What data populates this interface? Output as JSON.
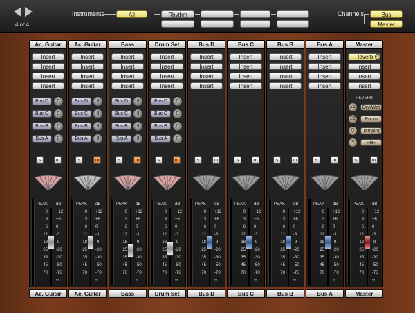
{
  "nav": {
    "page_indicator": "4 of 4",
    "prev_icon": "triangle-left-icon",
    "next_icon": "triangle-right-icon"
  },
  "instruments": {
    "label": "Instruments",
    "all_button": "All",
    "groups": [
      "Rhythm",
      "",
      "",
      "",
      "",
      "",
      "",
      ""
    ]
  },
  "channels": {
    "label": "Channels",
    "buttons": [
      "Bus",
      "Master"
    ]
  },
  "scale_left": [
    "PEAK",
    "0",
    "3",
    "6",
    "12",
    "18",
    "25",
    "35",
    "45",
    "70",
    "-"
  ],
  "scale_right": [
    "dB",
    "+12",
    "+6",
    "0",
    "-3",
    "-9",
    "-20",
    "-30",
    "-50",
    "-70",
    "∞"
  ],
  "colors": {
    "solo_active": "#e8701c",
    "bus_fader": "#2e5990",
    "master_fader": "#8a1414"
  },
  "strips": [
    {
      "name": "Ac. Guitar",
      "inserts": [
        "Insert",
        "Insert",
        "Insert",
        "Insert"
      ],
      "sends": [
        {
          "bus": "Bus D",
          "level": "0"
        },
        {
          "bus": "Bus C",
          "level": "0"
        },
        {
          "bus": "Bus B",
          "level": "0"
        },
        {
          "bus": "Bus A",
          "level": "0"
        }
      ],
      "solo": "s",
      "mute": "m",
      "mute_on": false,
      "pan_color": "#d9a0a0",
      "fader_level": 0.58,
      "fader_style": "gray",
      "footer": "Ac. Guitar"
    },
    {
      "name": "Ac. Guitar",
      "inserts": [
        "Insert",
        "Insert",
        "Insert",
        "Insert"
      ],
      "sends": [
        {
          "bus": "Bus D",
          "level": "0"
        },
        {
          "bus": "Bus C",
          "level": "0"
        },
        {
          "bus": "Bus B",
          "level": "0"
        },
        {
          "bus": "Bus A",
          "level": "0"
        }
      ],
      "solo": "s",
      "mute": "m",
      "mute_on": true,
      "pan_color": "#bdbdbd",
      "fader_level": 0.58,
      "fader_style": "gray",
      "footer": "Ac. Guitar"
    },
    {
      "name": "Bass",
      "inserts": [
        "Insert",
        "Insert",
        "Insert",
        "Insert"
      ],
      "sends": [
        {
          "bus": "Bus D",
          "level": "0"
        },
        {
          "bus": "Bus C",
          "level": "0"
        },
        {
          "bus": "Bus B",
          "level": "0"
        },
        {
          "bus": "Bus A",
          "level": "0"
        }
      ],
      "solo": "s",
      "mute": "m",
      "mute_on": true,
      "pan_color": "#d9a0a0",
      "fader_level": 0.45,
      "fader_style": "gray",
      "footer": "Bass"
    },
    {
      "name": "Drum Set",
      "inserts": [
        "Insert",
        "Insert",
        "Insert",
        "Insert"
      ],
      "sends": [
        {
          "bus": "Bus D",
          "level": "0"
        },
        {
          "bus": "Bus C",
          "level": "0"
        },
        {
          "bus": "Bus B",
          "level": "0"
        },
        {
          "bus": "Bus A",
          "level": "0"
        }
      ],
      "solo": "s",
      "mute": "m",
      "mute_on": true,
      "pan_color": "#d9a0a0",
      "fader_level": 0.48,
      "fader_style": "gray",
      "footer": "Drum Set"
    },
    {
      "name": "Bus D",
      "inserts": [
        "Insert",
        "Insert",
        "Insert",
        "Insert"
      ],
      "sends": [],
      "solo": "s",
      "mute": "m",
      "mute_on": false,
      "pan_color": "#9a9a9a",
      "fader_level": 0.58,
      "fader_style": "blue",
      "footer": "Bus D"
    },
    {
      "name": "Bus C",
      "inserts": [
        "Insert",
        "Insert",
        "Insert",
        "Insert"
      ],
      "sends": [],
      "solo": "s",
      "mute": "m",
      "mute_on": false,
      "pan_color": "#9a9a9a",
      "fader_level": 0.58,
      "fader_style": "blue",
      "footer": "Bus C"
    },
    {
      "name": "Bus B",
      "inserts": [
        "Insert",
        "Insert",
        "Insert",
        "Insert"
      ],
      "sends": [],
      "solo": "s",
      "mute": "m",
      "mute_on": false,
      "pan_color": "#9a9a9a",
      "fader_level": 0.58,
      "fader_style": "blue",
      "footer": "Bus B"
    },
    {
      "name": "Bus A",
      "inserts": [
        "Insert",
        "Insert",
        "Insert",
        "Insert"
      ],
      "sends": [],
      "solo": "s",
      "mute": "m",
      "mute_on": false,
      "pan_color": "#9a9a9a",
      "fader_level": 0.58,
      "fader_style": "blue",
      "footer": "Bus A"
    },
    {
      "name": "Master",
      "inserts": [
        "Reverb",
        "Insert",
        "Insert",
        "Insert"
      ],
      "insert_power_icon": "power-icon",
      "reverb": {
        "title": "REVERB",
        "params": [
          {
            "value": "21",
            "label": "Dry/Wet"
          },
          {
            "value": "22",
            "label": "Room"
          },
          {
            "value": "0",
            "label": "Damping"
          },
          {
            "value": "9",
            "label": "Pre-delay"
          }
        ]
      },
      "sends": [],
      "solo": "s",
      "mute": "m",
      "mute_on": false,
      "pan_color": "#9a9a9a",
      "fader_level": 0.58,
      "fader_style": "red",
      "footer": "Master"
    }
  ]
}
